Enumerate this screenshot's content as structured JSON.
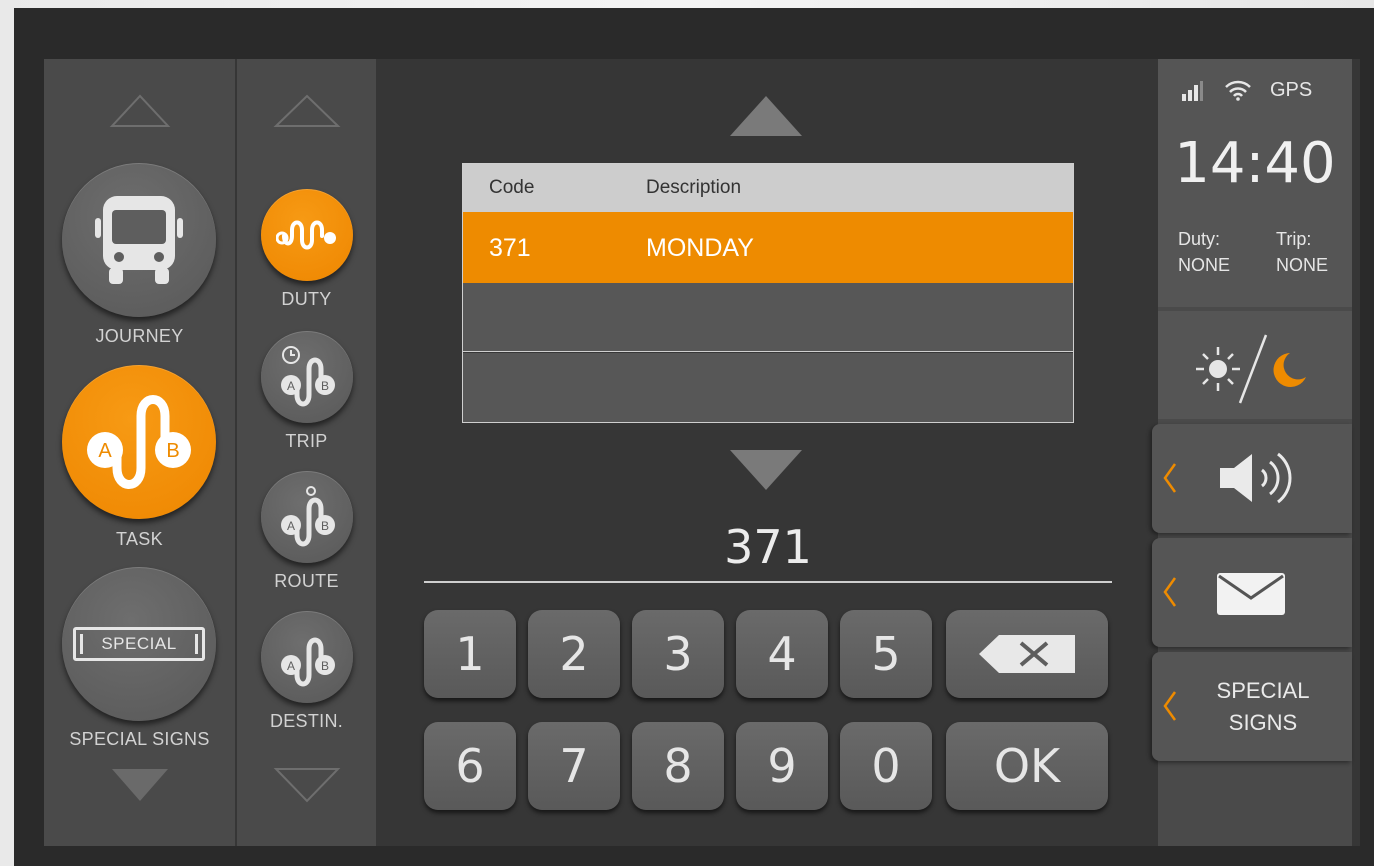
{
  "left_menu": {
    "items": [
      {
        "label": "JOURNEY",
        "icon": "bus-icon",
        "active": false
      },
      {
        "label": "TASK",
        "icon": "route-ab-icon",
        "active": true
      },
      {
        "label": "SPECIAL SIGNS",
        "icon": "special-sign-icon",
        "sign_text": "SPECIAL",
        "active": false
      }
    ]
  },
  "sub_menu": {
    "items": [
      {
        "label": "DUTY",
        "icon": "duty-icon",
        "active": true
      },
      {
        "label": "TRIP",
        "icon": "trip-icon",
        "active": false
      },
      {
        "label": "ROUTE",
        "icon": "route-icon",
        "active": false
      },
      {
        "label": "DESTIN.",
        "icon": "destination-icon",
        "active": false
      }
    ]
  },
  "table": {
    "headers": {
      "code": "Code",
      "description": "Description"
    },
    "rows": [
      {
        "code": "371",
        "description": "MONDAY",
        "selected": true
      },
      {
        "code": "",
        "description": "",
        "selected": false
      },
      {
        "code": "",
        "description": "",
        "selected": false
      }
    ]
  },
  "entry": {
    "value": "371"
  },
  "keypad": {
    "row1": [
      "1",
      "2",
      "3",
      "4",
      "5"
    ],
    "row2": [
      "6",
      "7",
      "8",
      "9",
      "0"
    ],
    "ok_label": "OK",
    "backspace_icon": "backspace-icon"
  },
  "status": {
    "gps_label": "GPS",
    "time": "14:40",
    "duty_label": "Duty:",
    "duty_value": "NONE",
    "trip_label": "Trip:",
    "trip_value": "NONE"
  },
  "right_panel": {
    "special_signs_line1": "SPECIAL",
    "special_signs_line2": "SIGNS"
  },
  "colors": {
    "accent": "#EE8B00",
    "panel": "#4A4A4A",
    "background": "#363636",
    "key": "#5F5F5F",
    "header": "#CDCDCD"
  }
}
